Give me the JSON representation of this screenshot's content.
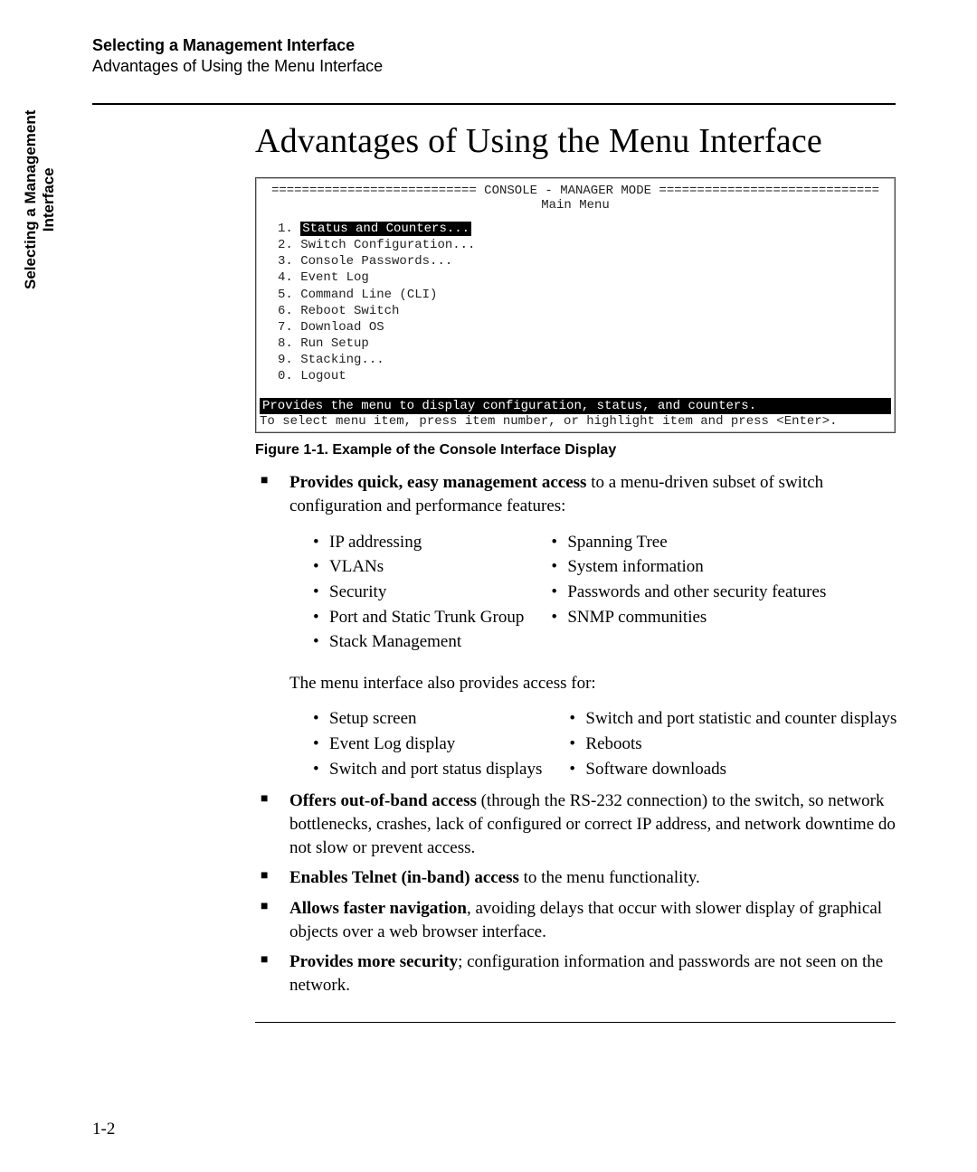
{
  "header": {
    "chapter": "Selecting a Management Interface",
    "section": "Advantages of Using the Menu Interface"
  },
  "side_tab": {
    "line1": "Selecting a Management",
    "line2": "Interface"
  },
  "title": "Advantages of Using the Menu Interface",
  "console": {
    "banner_left": "===========================",
    "banner_mid": " CONSOLE - MANAGER MODE ",
    "banner_right": "=============================",
    "subtitle": "Main Menu",
    "items": [
      {
        "num": "1.",
        "label": "Status and Counters...",
        "selected": true
      },
      {
        "num": "2.",
        "label": "Switch Configuration...",
        "selected": false
      },
      {
        "num": "3.",
        "label": "Console Passwords...",
        "selected": false
      },
      {
        "num": "4.",
        "label": "Event Log",
        "selected": false
      },
      {
        "num": "5.",
        "label": "Command Line (CLI)",
        "selected": false
      },
      {
        "num": "6.",
        "label": "Reboot Switch",
        "selected": false
      },
      {
        "num": "7.",
        "label": "Download OS",
        "selected": false
      },
      {
        "num": "8.",
        "label": "Run Setup",
        "selected": false
      },
      {
        "num": "9.",
        "label": "Stacking...",
        "selected": false
      },
      {
        "num": "0.",
        "label": "Logout",
        "selected": false
      }
    ],
    "status": "Provides the menu to display configuration, status, and counters.",
    "hint": "To select menu item, press item number, or highlight item and press <Enter>."
  },
  "figure_caption": "Figure 1-1.   Example of the Console Interface Display",
  "bullets": {
    "b1_lead": "Provides quick, easy management access",
    "b1_rest": " to a menu-driven subset of switch configuration and performance features:",
    "features_col1": [
      "IP addressing",
      "VLANs",
      "Security",
      "Port and Static Trunk Group",
      "Stack Management"
    ],
    "features_col2": [
      "Spanning Tree",
      "System information",
      "Passwords and other security features",
      "SNMP communities"
    ],
    "also_intro": "The menu interface also provides access for:",
    "also_col1": [
      "Setup screen",
      "Event Log display",
      "Switch and port status displays"
    ],
    "also_col2": [
      "Switch and port statistic and counter displays",
      "Reboots",
      "Software downloads"
    ],
    "b2_lead": "Offers out-of-band access",
    "b2_rest": " (through the RS-232 connection) to the switch, so network bottlenecks, crashes, lack of configured or correct IP address, and network downtime do not slow or prevent access.",
    "b3_lead": "Enables Telnet (in-band) access",
    "b3_rest": " to the menu functionality.",
    "b4_lead": "Allows faster navigation",
    "b4_rest": ", avoiding delays that occur with slower display of graphical objects over a web browser interface.",
    "b5_lead": "Provides more security",
    "b5_rest": "; configuration information and passwords are not seen on the network."
  },
  "page_number": "1-2"
}
